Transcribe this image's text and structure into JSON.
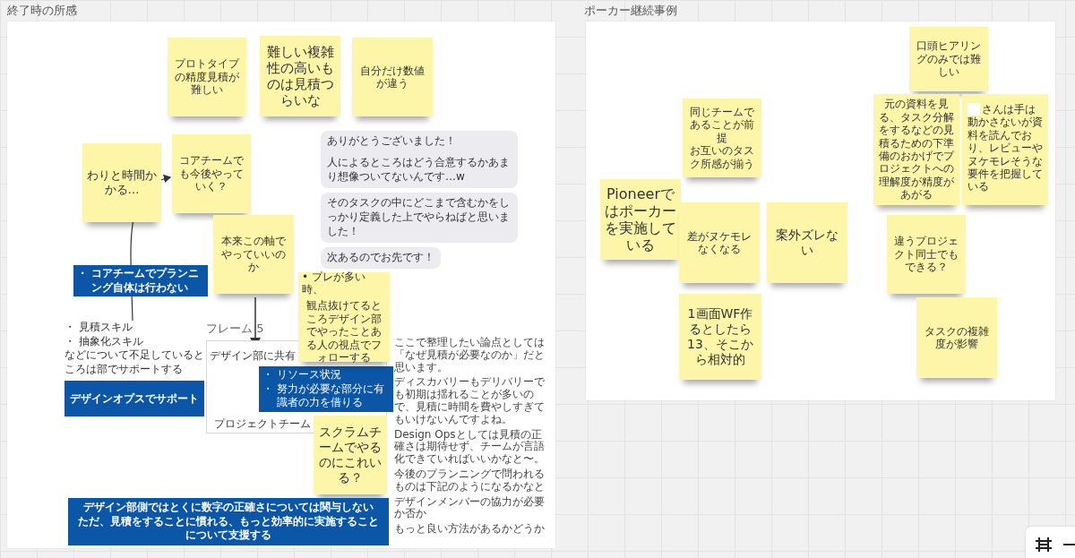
{
  "frames": [
    {
      "title": "終了時の所感",
      "stickies": [
        {
          "text": "プロトタイプの精度見積が難しい"
        },
        {
          "text": "難しい複雑性の高いものは見積つらいな"
        },
        {
          "text": "自分だけ数値が違う"
        },
        {
          "text": "わりと時間かかる…"
        },
        {
          "text": "コアチームでも今後やっていく？"
        },
        {
          "text": "本来この軸でやっていいのか"
        },
        {
          "marker": "•",
          "bullets": [
            "プレが多い時、"
          ],
          "text": "観点抜けてるところデザイン部でやったことある人の視点でフォローする"
        },
        {
          "text": "スクラムチームでやるのにこれいる？"
        }
      ],
      "chat_messages": [
        {
          "paragraphs": [
            "ありがとうございました！",
            "人によるところはどう合意するかあまり想像ついてないんです…w"
          ]
        },
        {
          "paragraphs": [
            "そのタスクの中にどこまで含むかをしっかり定義した上でやらねばと思いました！"
          ]
        },
        {
          "paragraphs": [
            "次あるのでお先です！"
          ]
        }
      ],
      "callout": {
        "marker": "・",
        "bullets": [
          "コアチームでプランニング自体は行わない"
        ]
      },
      "skills": {
        "marker": "・",
        "bullets": [
          "見積スキル",
          "抽象化スキル"
        ],
        "text": "などについて不足しているところは部でサポートする"
      },
      "support_button": "デザインオプスでサポート",
      "frame": {
        "title": "フレーム 5",
        "label": "デザイン部に共有",
        "marker": "・",
        "bullets": [
          "リソース状況",
          "努力が必要な部分に有識者の力を借りる"
        ],
        "footer": "プロジェクトチーム"
      },
      "note": {
        "paragraphs": [
          "ここで整理したい論点としては「なぜ見積が必要なのか」だと思います。",
          "ディスカバリーもデリバリーでも初期は揺れることが多いので、見積に時間を費やしすぎてもいけないんですよね。",
          "Design Opsとしては見積の正確さは期待せず、チームが言語化できていればいいかなと〜。",
          "今後のプランニングで問われるものは下記のようになるかなと"
        ],
        "lines": [
          "デザインメンバーの協力が必要か否か",
          "もっと良い方法があるかどうか"
        ]
      },
      "banner": {
        "lines": [
          "デザイン部側ではとくに数字の正確さについては関与しない",
          "ただ、見積をすることに慣れる、もっと効率的に実施することについて支援する"
        ]
      }
    },
    {
      "title": "ポーカー継続事例",
      "stickies": [
        {
          "text": "口頭ヒアリングのみでは難しい",
          "redacted": false
        },
        {
          "lines": [
            "同じチームであることが前提",
            "お互いのタスク所感が揃う"
          ],
          "redacted": false
        },
        {
          "text": "元の資料を見る、タスク分解をするなどの見積るための下準備のおかげでプロジェクトへの理解度が精度があがる",
          "redacted": false
        },
        {
          "text": "さんは手は動かさないが資料を読んでおり、レビューやヌケモレそうな要件を把握している",
          "redacted": true
        },
        {
          "text": "Pioneerではポーカーを実施している",
          "redacted": false
        },
        {
          "text": "差がヌケモレなくなる",
          "redacted": false
        },
        {
          "text": "案外ズレない",
          "redacted": false
        },
        {
          "text": "違うプロジェクト同士でもできる？",
          "redacted": false
        },
        {
          "text": "1画面WF作るとしたら13、そこから相対的",
          "redacted": false
        },
        {
          "text": "タスクの複雑度が影響",
          "redacted": false
        }
      ]
    }
  ]
}
